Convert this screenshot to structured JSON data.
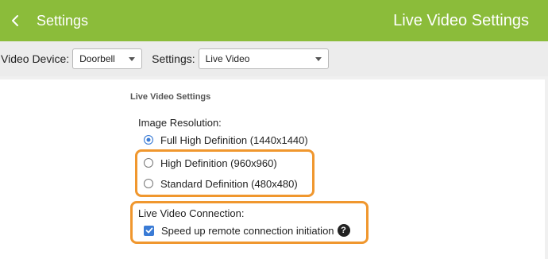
{
  "header": {
    "back_label": "Settings",
    "title": "Live Video Settings"
  },
  "toolbar": {
    "device_label": "Video Device:",
    "device_value": "Doorbell",
    "settings_label": "Settings:",
    "settings_value": "Live Video"
  },
  "section": {
    "title": "Live Video Settings",
    "resolution_label": "Image Resolution:",
    "resolution_options": [
      {
        "label": "Full High Definition (1440x1440)",
        "checked": true
      },
      {
        "label": "High Definition (960x960)",
        "checked": false
      },
      {
        "label": "Standard Definition (480x480)",
        "checked": false
      }
    ],
    "connection_label": "Live Video Connection:",
    "connection_checkbox_label": "Speed up remote connection initiation",
    "connection_checkbox_checked": true,
    "help_glyph": "?"
  },
  "colors": {
    "header_bg": "#8bbc3a",
    "accent": "#3a7bd5",
    "highlight": "#f0972e"
  },
  "icons": [
    "chevron-left-icon",
    "caret-down-icon",
    "checkmark-icon",
    "help-icon"
  ]
}
